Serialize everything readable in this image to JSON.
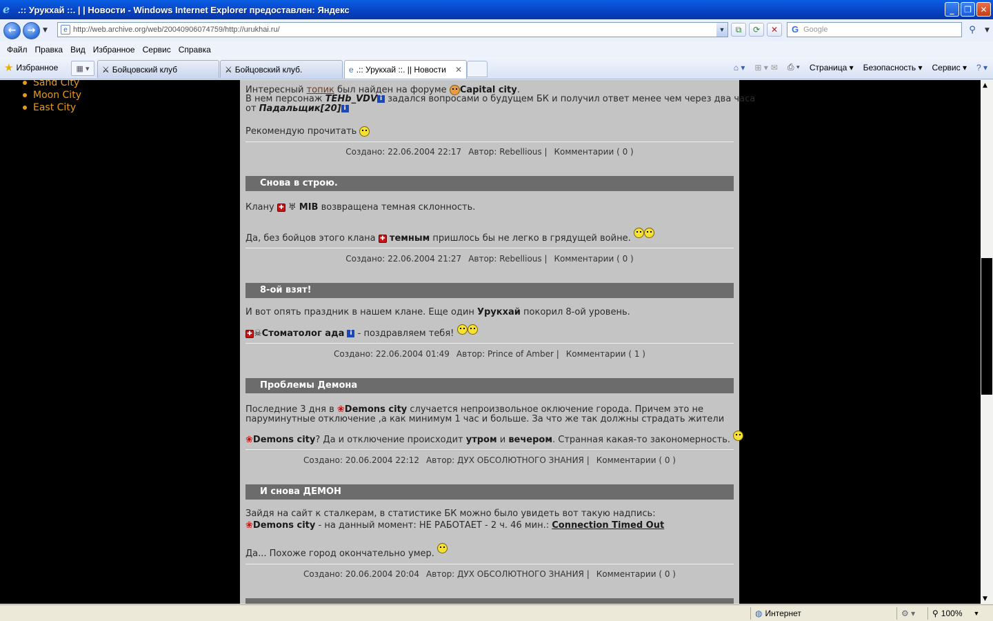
{
  "window": {
    "title": ".:: Урукхай ::. | | Новости - Windows Internet Explorer предоставлен: Яндекс"
  },
  "addressbar": {
    "url": "http://web.archive.org/web/20040906074759/http://urukhai.ru/",
    "search_placeholder": "Google"
  },
  "menu": [
    "Файл",
    "Правка",
    "Вид",
    "Избранное",
    "Сервис",
    "Справка"
  ],
  "favorites_label": "Избранное",
  "tabs": [
    {
      "label": "Бойцовский клуб",
      "active": false
    },
    {
      "label": "Бойцовский клуб.",
      "active": false
    },
    {
      "label": ".:: Урукхай ::. || Новости",
      "active": true
    }
  ],
  "toolbar": {
    "page_label": "Страница",
    "security_label": "Безопасность",
    "tools_label": "Сервис"
  },
  "sidebar": {
    "cities": [
      "Sand City",
      "Moon City",
      "East City"
    ]
  },
  "posts": [
    {
      "p1_pre": "Интересный ",
      "p1_link": "топик",
      "p1_mid": " был найден на форуме ",
      "p1_bold": "Capital city",
      "p1_end": ".",
      "p2_pre": "В нем персонаж ",
      "p2_bold": "TEHb_VDV",
      "p2_post": " задался вопросами о будущем БК и получил ответ менее чем через два часа",
      "p3_pre": "от ",
      "p3_bold": "Падальщик[20]",
      "p4": "Рекомендую прочитать",
      "created": "Создано: 22.06.2004 22:17",
      "author": "Автор: Rebellious |",
      "comments": "Комментарии ( 0 )"
    },
    {
      "title": "Снова в строю.",
      "p1_pre": "Клану",
      "p1_bold": "MIB",
      "p1_post": " возвращена темная склонность.",
      "p2_pre": "Да, без бойцов этого клана",
      "p2_bold": "темным",
      "p2_post": " пришлось бы не легко в грядущей войне.",
      "created": "Создано: 22.06.2004 21:27",
      "author": "Автор: Rebellious |",
      "comments": "Комментарии ( 0 )"
    },
    {
      "title": "8-ой взят!",
      "p1_pre": "И вот опять праздник в нашем клане. Еще один ",
      "p1_bold": "Урукхай",
      "p1_post": " покорил 8-ой уровень.",
      "p2_bold": "Стоматолог ада",
      "p2_post": " - поздравляем тебя!",
      "created": "Создано: 22.06.2004 01:49",
      "author": "Автор: Prince of Amber |",
      "comments": "Комментарии ( 1 )"
    },
    {
      "title": "Проблемы Демона",
      "p1_pre": "Последние 3 дня в ",
      "p1_bold": "Demons city",
      "p1_post": " случается непроизвольное оключение города. Причем это не",
      "p2": "паруминутные отключение ,а как минимум 1 час и больше. За что же так должны страдать жители",
      "p3_bold": "Demons city",
      "p3_mid": "? Да и отключение происходит ",
      "p3_bold2": "утром",
      "p3_and": " и ",
      "p3_bold3": "вечером",
      "p3_post": ". Странная какая-то закономерность.",
      "created": "Создано: 20.06.2004 22:12",
      "author": "Автор: ДУХ ОБСОЛЮТНОГО ЗНАНИЯ |",
      "comments": "Комментарии ( 0 )"
    },
    {
      "title": "И снова ДЕМОН",
      "p1": "Зайдя на сайт к сталкерам, в статистике БК можно было увидеть вот такую надпись:",
      "p2_bold": "Demons city",
      "p2_post": " - на данный момент: НЕ РАБОТАЕТ - 2 ч. 46 мин.: ",
      "p2_link": "Connection Timed Out",
      "p3": "Да... Похоже город окончательно умер.",
      "created": "Создано: 20.06.2004 20:04",
      "author": "Автор: ДУХ ОБСОЛЮТНОГО ЗНАНИЯ |",
      "comments": "Комментарии ( 0 )"
    }
  ],
  "status": {
    "zone": "Интернет",
    "zoom": "100%"
  }
}
